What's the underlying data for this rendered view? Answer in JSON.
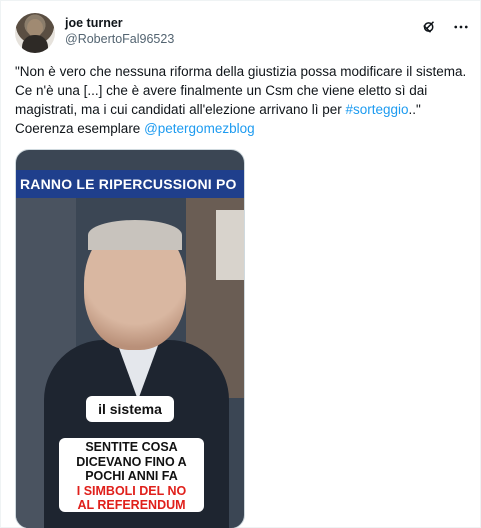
{
  "post": {
    "author": {
      "display_name": "joe turner",
      "handle": "@RobertoFal96523"
    },
    "text_parts": {
      "part1": "\"Non è vero che nessuna riforma della giustizia possa modificare il sistema. Ce n'è una [...] che è avere finalmente un Csm che viene eletto sì dai magistrati, ma i cui candidati all'elezione arrivano lì per ",
      "hashtag": "#sorteggio",
      "part2": "..\" Coerenza esemplare ",
      "mention": "@petergomezblog"
    },
    "video": {
      "banner_text": "RANNO LE RIPERCUSSIONI PO",
      "caption": "il sistema",
      "overlay_lines": {
        "line1": "SENTITE COSA",
        "line2": "DICEVANO FINO A",
        "line3": "POCHI ANNI FA",
        "line4": "I SIMBOLI DEL NO",
        "line5": "AL REFERENDUM"
      }
    }
  },
  "icons": {
    "grok": "grok-icon",
    "more": "more-icon"
  },
  "colors": {
    "link": "#1d9bf0",
    "handle": "#536471",
    "banner": "#1f3f8c",
    "overlay_red": "#e0201b"
  }
}
